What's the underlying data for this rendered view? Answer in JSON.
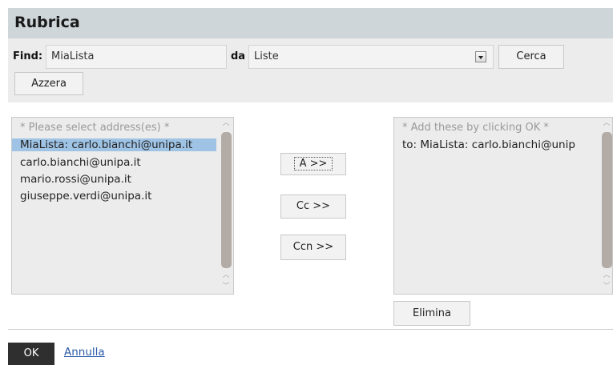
{
  "window": {
    "title": "Rubrica"
  },
  "search": {
    "find_label": "Find:",
    "find_value": "MiaLista",
    "da_label": "da",
    "source_value": "Liste",
    "search_button": "Cerca",
    "reset_button": "Azzera"
  },
  "left_list": {
    "placeholder": "* Please select address(es) *",
    "items": [
      "MiaLista: carlo.bianchi@unipa.it",
      "carlo.bianchi@unipa.it",
      "mario.rossi@unipa.it",
      "giuseppe.verdi@unipa.it"
    ],
    "selected_index": 0
  },
  "actions": {
    "to_button": "A >>",
    "cc_button": "Cc >>",
    "bcc_button": "Ccn >>"
  },
  "right_list": {
    "placeholder": "* Add these by clicking OK *",
    "items": [
      "to: MiaLista: carlo.bianchi@unip"
    ],
    "delete_button": "Elimina"
  },
  "footer": {
    "ok_button": "OK",
    "cancel_link": "Annulla"
  },
  "colors": {
    "titlebar": "#cfd6d9",
    "selection": "#9fc3e5",
    "ok_button": "#2f2f2f",
    "link": "#2a5aa8"
  }
}
